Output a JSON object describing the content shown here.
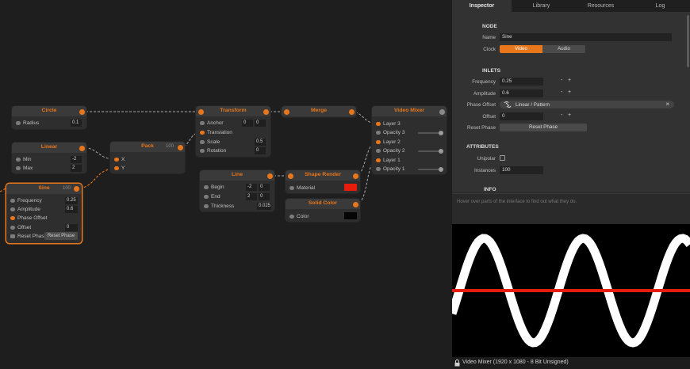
{
  "tabs": [
    "Inspector",
    "Library",
    "Resources",
    "Log"
  ],
  "nodes": {
    "circle": {
      "title": "Circle",
      "radius_label": "Radius",
      "radius": "0.1"
    },
    "linear": {
      "title": "Linear",
      "min_label": "Min",
      "min": "-2",
      "max_label": "Max",
      "max": "2"
    },
    "sine": {
      "title": "Sine",
      "count": "100",
      "frequency_label": "Frequency",
      "frequency": "0.25",
      "amplitude_label": "Amplitude",
      "amplitude": "0.6",
      "phase_label": "Phase Offset",
      "offset_label": "Offset",
      "offset": "0",
      "reset_label": "Reset Phase",
      "reset_button": "Reset Phase"
    },
    "pack": {
      "title": "Pack",
      "count": "100",
      "x_label": "X",
      "y_label": "Y"
    },
    "transform": {
      "title": "Transform",
      "anchor_label": "Anchor",
      "anchor_x": "0",
      "anchor_y": "0",
      "translation_label": "Translation",
      "scale_label": "Scale",
      "scale": "0.5",
      "rotation_label": "Rotation",
      "rotation": "0"
    },
    "line": {
      "title": "Line",
      "begin_label": "Begin",
      "begin_x": "-2",
      "begin_y": "0",
      "end_label": "End",
      "end_x": "2",
      "end_y": "0",
      "thickness_label": "Thickness",
      "thickness": "0.025"
    },
    "merge": {
      "title": "Merge"
    },
    "shape_render": {
      "title": "Shape Render",
      "material_label": "Material",
      "material_color": "#e81c0c"
    },
    "solid_color": {
      "title": "Solid Color",
      "color_label": "Color",
      "color": "#050505"
    },
    "video_mixer": {
      "title": "Video Mixer",
      "layer3": "Layer 3",
      "opacity3": "Opacity 3",
      "layer2": "Layer 2",
      "opacity2": "Opacity 2",
      "layer1": "Layer 1",
      "opacity1": "Opacity 1"
    }
  },
  "inspector": {
    "node_section": "NODE",
    "name_label": "Name",
    "name_value": "Sine",
    "clock_label": "Clock",
    "clock_options": [
      "Video",
      "Audio"
    ],
    "clock_selected": "Video",
    "inlets_section": "INLETS",
    "frequency_label": "Frequency",
    "frequency": "0.25",
    "amplitude_label": "Amplitude",
    "amplitude": "0.6",
    "phase_label": "Phase Offset",
    "phase_value": "Linear / Pattern",
    "offset_label": "Offset",
    "offset": "0",
    "reset_label": "Reset Phase",
    "reset_button": "Reset Phase",
    "attributes_section": "ATTRIBUTES",
    "unipolar_label": "Unipolar",
    "unipolar_checked": false,
    "instances_label": "Instances",
    "instances": "100",
    "info_section": "INFO",
    "minus": "-",
    "plus": "+"
  },
  "help_text": "Hover over parts of the interface to find out what they do.",
  "status": "Video Mixer (1920 x 1080 - 8 Bit Unsigned)",
  "colors": {
    "accent": "#e8761a",
    "wave": "#ffffff",
    "line": "#e81c0c"
  }
}
